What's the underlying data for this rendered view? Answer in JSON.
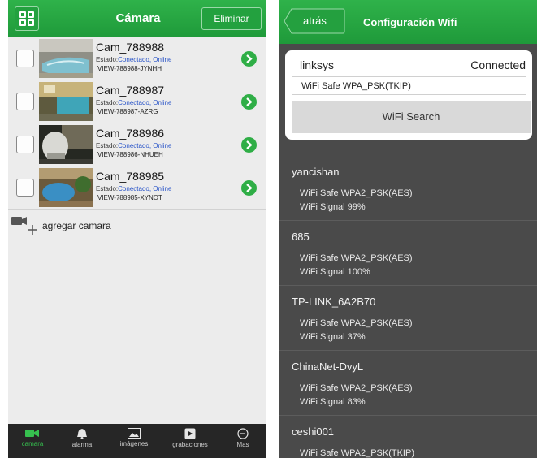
{
  "left": {
    "header": {
      "title": "Cámara",
      "delete_label": "Eliminar"
    },
    "status_prefix": "Estado:",
    "cameras": [
      {
        "name": "Cam_788988",
        "status": "Conectado, Online",
        "view_id": "VIEW-788988-JYNHH"
      },
      {
        "name": "Cam_788987",
        "status": "Conectado, Online",
        "view_id": "VIEW-788987-AZRG"
      },
      {
        "name": "Cam_788986",
        "status": "Conectado, Online",
        "view_id": "VIEW-788986-NHUEH"
      },
      {
        "name": "Cam_788985",
        "status": "Conectado, Online",
        "view_id": "VIEW-788985-XYNOT"
      }
    ],
    "add_camera_label": "agregar camara",
    "tabs": [
      {
        "label": "camara",
        "icon": "video-camera-icon",
        "active": true
      },
      {
        "label": "alarma",
        "icon": "bell-icon",
        "active": false
      },
      {
        "label": "imágenes",
        "icon": "image-icon",
        "active": false
      },
      {
        "label": "grabaciones",
        "icon": "play-icon",
        "active": false
      },
      {
        "label": "Mas",
        "icon": "more-icon",
        "active": false
      }
    ]
  },
  "right": {
    "header": {
      "back_label": "atrás",
      "title": "Configuración Wifi"
    },
    "connected": {
      "ssid": "linksys",
      "state": "Connected",
      "safe_text": "WiFi Safe  WPA_PSK(TKIP)",
      "search_label": "WiFi Search"
    },
    "networks": [
      {
        "ssid": "yancishan",
        "safe": "WiFi Safe  WPA2_PSK(AES)",
        "signal": "WiFi Signal  99%"
      },
      {
        "ssid": "685",
        "safe": "WiFi Safe  WPA2_PSK(AES)",
        "signal": "WiFi Signal  100%"
      },
      {
        "ssid": "TP-LINK_6A2B70",
        "safe": "WiFi Safe  WPA2_PSK(AES)",
        "signal": "WiFi Signal  37%"
      },
      {
        "ssid": "ChinaNet-DvyL",
        "safe": "WiFi Safe  WPA2_PSK(AES)",
        "signal": "WiFi Signal  83%"
      },
      {
        "ssid": "ceshi001",
        "safe": "WiFi Safe  WPA2_PSK(TKIP)",
        "signal": ""
      }
    ]
  },
  "colors": {
    "brand_green": "#2fb24a",
    "link_blue": "#2a55c8",
    "dark_panel": "#4a4a4a",
    "footer": "#262626"
  }
}
